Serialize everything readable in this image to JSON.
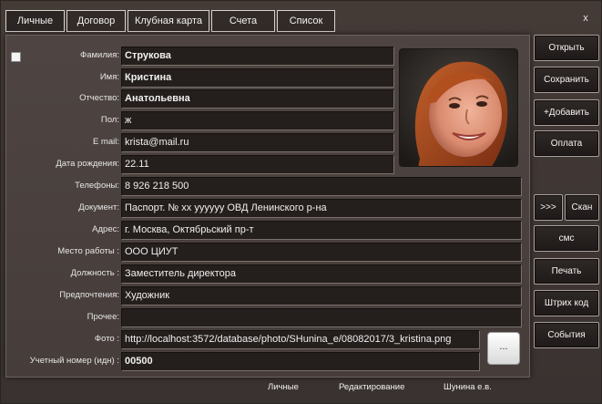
{
  "tabs": [
    {
      "label": "Личные"
    },
    {
      "label": "Договор"
    },
    {
      "label": "Клубная карта"
    },
    {
      "label": "Счета"
    },
    {
      "label": "Список"
    }
  ],
  "close_label": "x",
  "form": {
    "last_name": {
      "label": "Фамилия:",
      "value": "Струкова"
    },
    "first_name": {
      "label": "Имя:",
      "value": "Кристина"
    },
    "patronymic": {
      "label": "Отчество:",
      "value": "Анатольевна"
    },
    "gender": {
      "label": "Пол:",
      "value": "ж"
    },
    "email": {
      "label": "E mail:",
      "value": "krista@mail.ru"
    },
    "birth_date": {
      "label": "Дата рождения:",
      "value": "22.11"
    },
    "phones": {
      "label": "Телефоны:",
      "value": "8 926 218 500"
    },
    "document": {
      "label": "Документ:",
      "value": "Паспорт. № хх уууууу  ОВД Ленинского р-на"
    },
    "address": {
      "label": "Адрес:",
      "value": "г. Москва,    Октябрьский пр-т"
    },
    "workplace": {
      "label": "Место работы :",
      "value": "ООО ЦИУТ"
    },
    "position": {
      "label": "Должность :",
      "value": "Заместитель директора"
    },
    "preferences": {
      "label": "Предпочтения:",
      "value": "Художник"
    },
    "other": {
      "label": "Прочее:",
      "value": ""
    },
    "photo": {
      "label": "Фото :",
      "value": "http://localhost:3572/database/photo/SHunina_e/08082017/3_kristina.png"
    },
    "account_no": {
      "label": "Учетный номер (идн) :",
      "value": "00500"
    }
  },
  "browse_label": "...",
  "buttons": {
    "open": "Открыть",
    "save": "Сохранить",
    "add": "+Добавить",
    "payment": "Оплата",
    "forward": ">>>",
    "scan": "Скан",
    "sms": "смс",
    "print": "Печать",
    "barcode": "Штрих код",
    "events": "События"
  },
  "status": {
    "section": "Личные",
    "mode": "Редактирование",
    "user": "Шунина е.в."
  },
  "colors": {
    "background": "#3a3330",
    "field": "#241e1c",
    "text": "#f0f0f0"
  }
}
